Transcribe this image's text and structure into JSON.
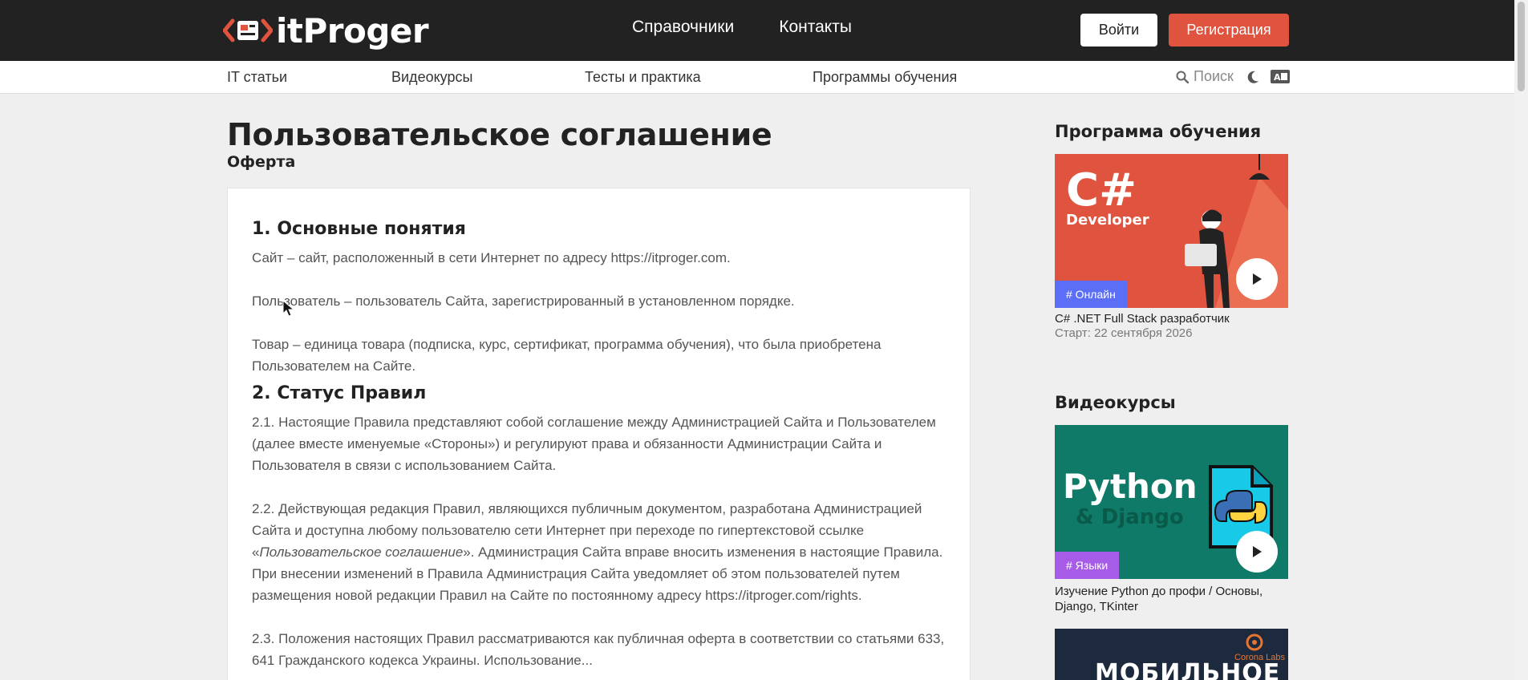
{
  "header": {
    "logo_text": "itProger",
    "nav": [
      "Справочники",
      "Контакты"
    ],
    "login": "Войти",
    "register": "Регистрация",
    "brand_color": "#e0533f"
  },
  "subnav": {
    "items": [
      "IT статьи",
      "Видеокурсы",
      "Тесты и практика",
      "Программы обучения"
    ],
    "search": "Поиск",
    "icons": [
      "search-icon",
      "moon-icon",
      "translate-icon"
    ]
  },
  "page": {
    "title": "Пользовательское соглашение",
    "subtitle": "Оферта"
  },
  "content": {
    "h1": "1. Основные понятия",
    "p1": "Сайт – сайт, расположенный в сети Интернет по адресу https://itproger.com.",
    "p2": "Пользователь – пользователь Сайта, зарегистрированный в установленном порядке.",
    "p3": "Товар – единица товара (подписка, курс, сертификат, программа обучения), что была приобретена Пользователем на Сайте.",
    "h2": "2. Статус Правил",
    "p4": "2.1. Настоящие Правила представляют собой соглашение между Администрацией Сайта и Пользователем (далее вместе именуемые «Стороны») и регулируют права и обязанности Администрации Сайта и Пользователя в связи с использованием Сайта.",
    "p5_a": "2.2. Действующая редакция Правил, являющихся публичным документом, разработана Администрацией Сайта и доступна любому пользователю сети Интернет при переходе по гипертекстовой ссылке «",
    "p5_em": "Пользовательское соглашение",
    "p5_b": "». Администрация Сайта вправе вносить изменения в настоящие Правила. При внесении изменений в Правила Администрация Сайта уведомляет об этом пользователей путем размещения новой редакции Правил на Сайте по постоянному адресу https://itproger.com/rights.",
    "p6": "2.3. Положения настоящих Правил рассматриваются как публичная оферта в соответствии со статьями 633, 641 Гражданского кодекса Украины. Использование..."
  },
  "sidebar": {
    "program_heading": "Программа обучения",
    "program": {
      "image_title": "C#",
      "image_subtitle": "Developer",
      "tag": "# Онлайн",
      "title": "C# .NET Full Stack разработчик",
      "start": "Старт: 22 сентября 2026",
      "bg": "#e0533f",
      "tag_color": "#5b6ef5"
    },
    "courses_heading": "Видеокурсы",
    "course1": {
      "image_title": "Python",
      "image_subtitle": "& Django",
      "tag": "# Языки",
      "title": "Изучение Python до профи / Основы, Django, TKinter",
      "bg": "#0f7a68",
      "tag_color": "#a75ce8"
    },
    "course2": {
      "image_title": "МОБИЛЬНОЕ",
      "badge": "Corona Labs"
    }
  }
}
